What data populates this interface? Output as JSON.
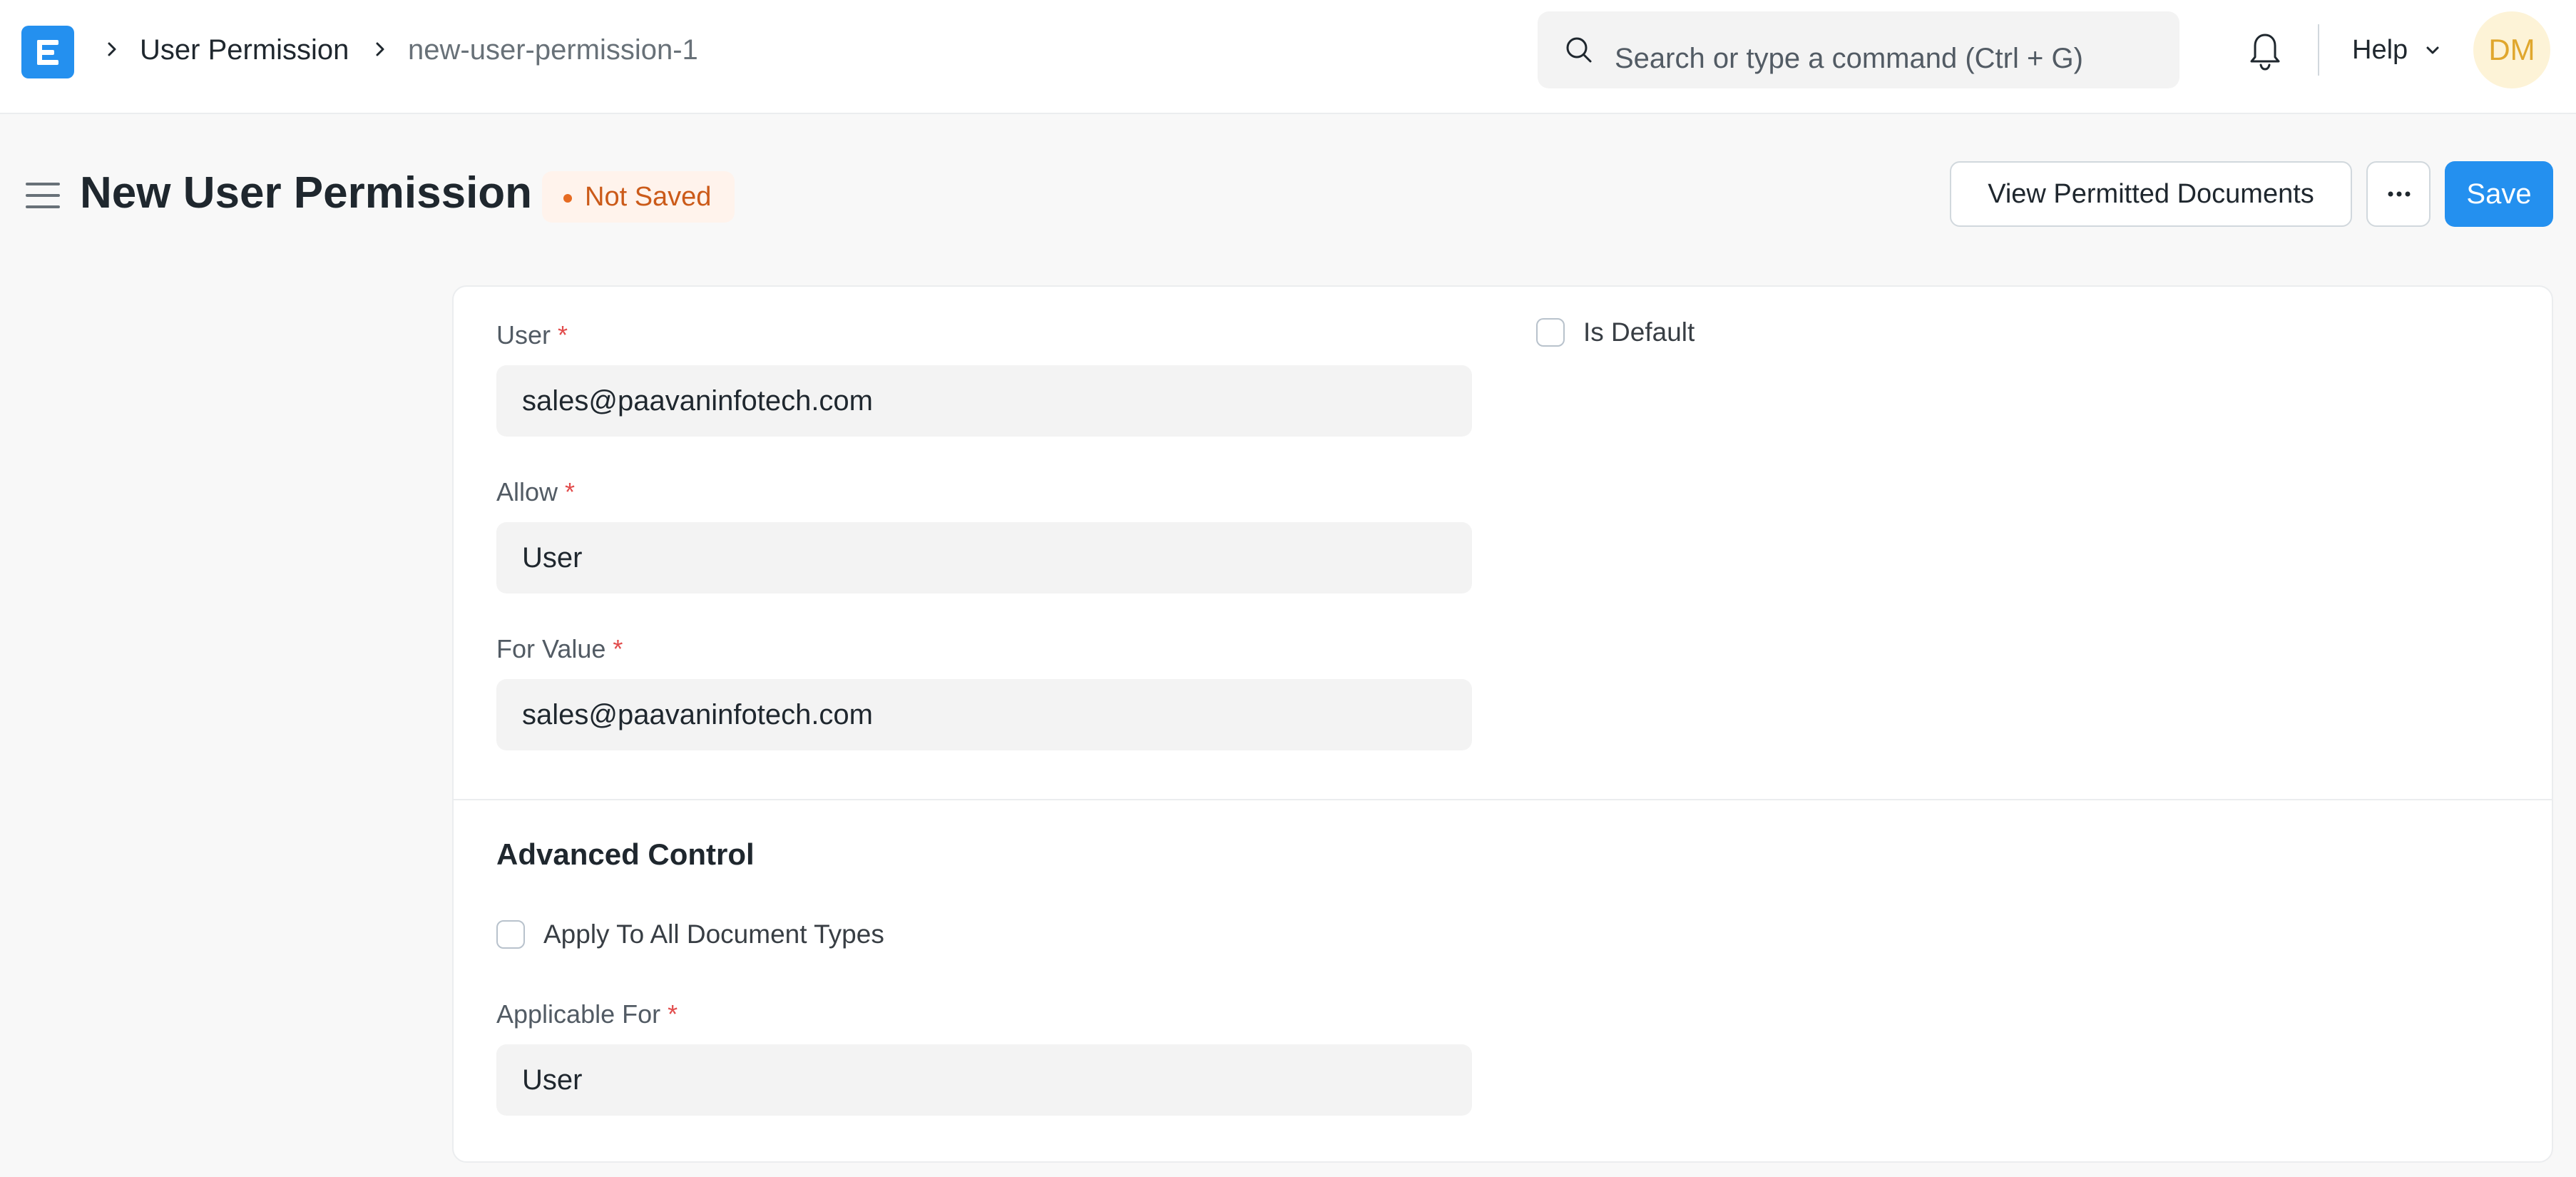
{
  "navbar": {
    "logo_letter": "E",
    "breadcrumbs": [
      "User Permission",
      "new-user-permission-1"
    ],
    "search_placeholder": "Search or type a command (Ctrl + G)",
    "help_label": "Help",
    "avatar_initials": "DM"
  },
  "page": {
    "title": "New User Permission",
    "status": "Not Saved",
    "actions": {
      "view_permitted": "View Permitted Documents",
      "more": "...",
      "save": "Save"
    }
  },
  "form": {
    "user": {
      "label": "User",
      "required": "*",
      "value": "sales@paavaninfotech.com"
    },
    "allow": {
      "label": "Allow",
      "required": "*",
      "value": "User"
    },
    "for_value": {
      "label": "For Value",
      "required": "*",
      "value": "sales@paavaninfotech.com"
    },
    "is_default": {
      "label": "Is Default",
      "checked": false
    },
    "advanced": {
      "title": "Advanced Control",
      "apply_all": {
        "label": "Apply To All Document Types",
        "checked": false
      },
      "applicable_for": {
        "label": "Applicable For",
        "required": "*",
        "value": "User"
      }
    }
  },
  "colors": {
    "primary": "#2490ef",
    "status_text": "#cb5a19",
    "status_bg": "#fff3ec",
    "required": "#e24c4c",
    "avatar_bg": "#fdf3d7",
    "avatar_text": "#e0a72d"
  },
  "icons": [
    "app-logo-icon",
    "chevron-right-icon",
    "search-icon",
    "bell-icon",
    "chevron-down-icon",
    "hamburger-icon",
    "more-dots-icon"
  ]
}
